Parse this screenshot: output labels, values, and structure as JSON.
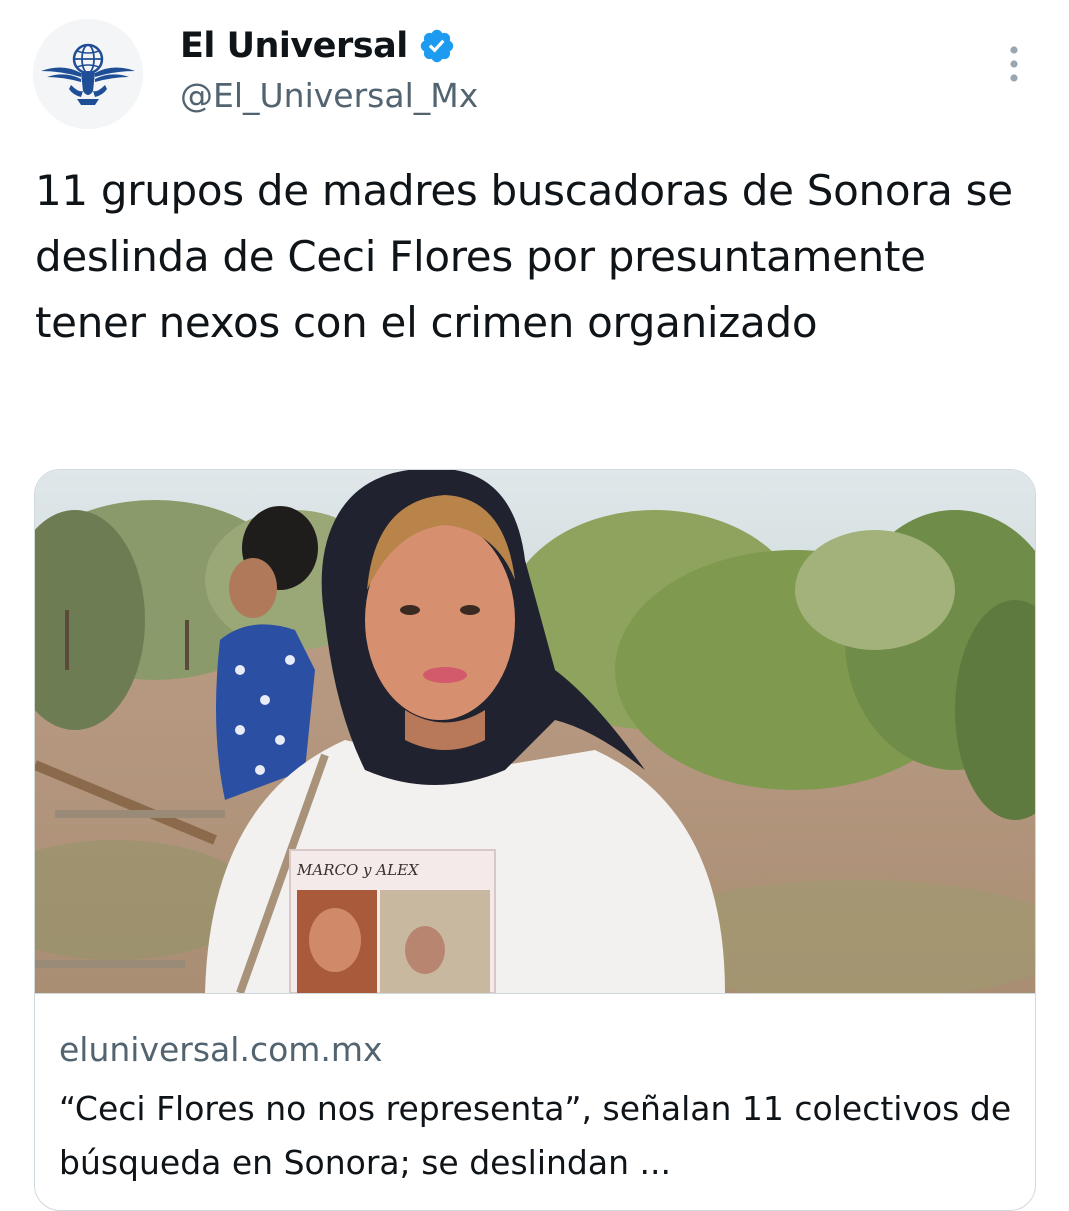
{
  "author": {
    "display_name": "El Universal",
    "handle": "@El_Universal_Mx",
    "verified": true,
    "avatar_icon": "eagle-globe-logo-icon"
  },
  "tweet": {
    "text": "11 grupos de madres buscadoras de Sonora se deslinda de Ceci Flores por presuntamente tener nexos con el crimen organizado"
  },
  "link_card": {
    "image_alt": "Mujer con pañuelo oscuro en la cabeza y camiseta blanca con fotos, en un campo con matorrales",
    "shirt_text": "MARCO y ALEX",
    "domain": "eluniversal.com.mx",
    "title": "“Ceci Flores no nos representa”, señalan 11 colectivos de búsqueda en Sonora; se deslindan ..."
  },
  "icons": {
    "verified": "verified-badge-icon",
    "more": "more-options-icon"
  },
  "colors": {
    "verified_blue": "#1d9bf0",
    "secondary_text": "#536471",
    "primary_text": "#0f1419",
    "border": "#cfd9de",
    "logo_blue": "#1f4e96"
  }
}
